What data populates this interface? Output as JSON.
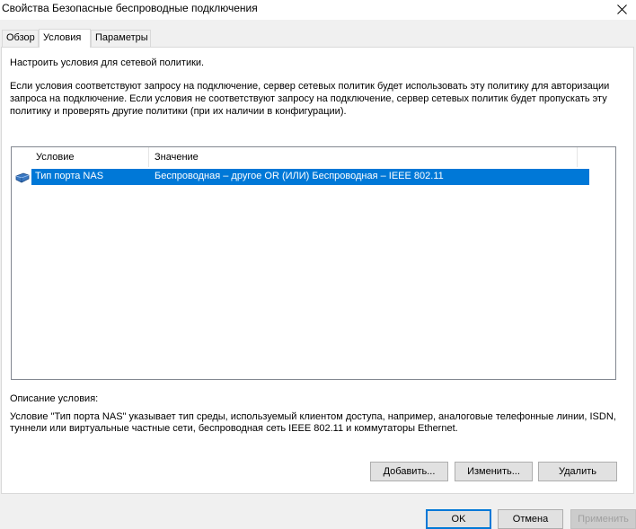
{
  "window": {
    "title": "Свойства Безопасные беспроводные подключения"
  },
  "tabs": [
    {
      "label": "Обзор"
    },
    {
      "label": "Условия"
    },
    {
      "label": "Параметры"
    }
  ],
  "conditions": {
    "intro": "Настроить условия для сетевой политики.",
    "description": "Если условия соответствуют запросу на подключение, сервер сетевых политик будет использовать эту политику для авторизации запроса на подключение. Если условия не соответствуют запросу на подключение, сервер сетевых политик будет пропускать эту политику и проверять другие политики (при их наличии в конфигурации).",
    "columns": {
      "condition": "Условие",
      "value": "Значение"
    },
    "rows": [
      {
        "condition": "Тип порта NAS",
        "value": "Беспроводная – другое OR (ИЛИ) Беспроводная – IEEE 802.11"
      }
    ],
    "description_label": "Описание условия:",
    "description_text": "Условие \"Тип порта NAS\" указывает тип среды, используемый клиентом доступа, например, аналоговые телефонные линии, ISDN, туннели или виртуальные частные сети, беспроводная сеть IEEE 802.11 и коммутаторы Ethernet.",
    "buttons": {
      "add": "Добавить...",
      "edit": "Изменить...",
      "remove": "Удалить"
    }
  },
  "footer": {
    "ok": "OK",
    "cancel": "Отмена",
    "apply": "Применить"
  },
  "colors": {
    "selection": "#0078d7",
    "panel": "#ffffff",
    "dialog": "#f0f0f0"
  }
}
